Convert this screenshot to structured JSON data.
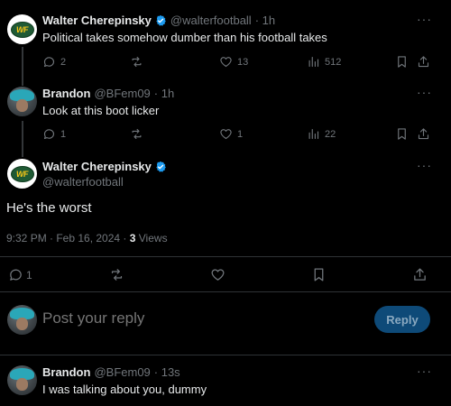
{
  "posts": [
    {
      "name": "Walter Cherepinsky",
      "verified": true,
      "handle": "@walterfootball",
      "time": "· 1h",
      "text": "Political takes somehow dumber than his football takes",
      "replies": "2",
      "likes": "13",
      "views": "512",
      "avatar_text": "WF"
    },
    {
      "name": "Brandon",
      "handle": "@BFem09",
      "time": "· 1h",
      "text": "Look at this boot licker",
      "replies": "1",
      "likes": "1",
      "views": "22"
    }
  ],
  "main_post": {
    "name": "Walter Cherepinsky",
    "verified": true,
    "handle": "@walterfootball",
    "text": "He's the worst",
    "timestamp": "9:32 PM · Feb 16, 2024 · ",
    "views_count": "3",
    "views_label": " Views",
    "replies": "1",
    "avatar_text": "WF"
  },
  "composer": {
    "placeholder": "Post your reply",
    "button_label": "Reply"
  },
  "reply_post": {
    "name": "Brandon",
    "handle": "@BFem09",
    "time": "· 13s",
    "text": "I was talking about you, dummy"
  },
  "more_label": "···",
  "colors": {
    "background": "#000000",
    "text": "#e7e9ea",
    "muted": "#71767b",
    "verified": "#1d9bf0",
    "reply_button": "#0e4a78"
  }
}
